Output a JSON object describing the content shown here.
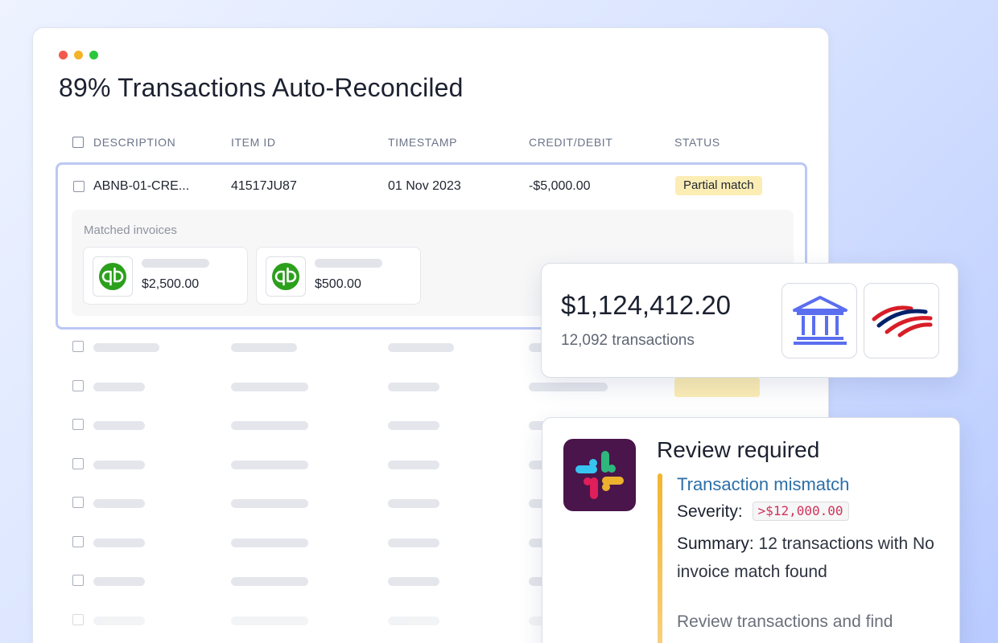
{
  "window": {
    "title": "89% Transactions Auto-Reconciled"
  },
  "table": {
    "columns": [
      "DESCRIPTION",
      "ITEM ID",
      "TIMESTAMP",
      "CREDIT/DEBIT",
      "STATUS"
    ],
    "expanded_row": {
      "description": "ABNB-01-CRE...",
      "item_id": "41517JU87",
      "timestamp": "01 Nov 2023",
      "amount": "-$5,000.00",
      "status": "Partial match",
      "matched_label": "Matched invoices",
      "invoices": [
        {
          "amount": "$2,500.00",
          "icon": "quickbooks-icon"
        },
        {
          "amount": "$500.00",
          "icon": "quickbooks-icon"
        }
      ]
    },
    "placeholder_rows": 8
  },
  "balance_card": {
    "amount": "$1,124,412.20",
    "count": "12,092 transactions",
    "icons": [
      "bank-icon",
      "bank-of-america-logo"
    ]
  },
  "review_card": {
    "title": "Review required",
    "alert_title": "Transaction mismatch",
    "severity_label": "Severity:",
    "severity_value": ">$12,000.00",
    "summary_label": "Summary:",
    "summary_value": "12 transactions with No invoice match found",
    "note": "Review transactions and find"
  },
  "colors": {
    "accent_border": "#bcc8f5",
    "badge_bg": "#fcedb5",
    "link_blue": "#2d6fa8",
    "severity_red": "#d0335b",
    "warning_bar": "#f2b530",
    "bank_blue": "#5b6ef0",
    "slack_bg": "#4a154b",
    "quickbooks_green": "#2ca01c"
  }
}
